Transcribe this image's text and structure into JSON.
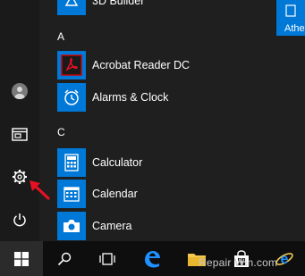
{
  "apps": {
    "partial_top_label": "3D Builder",
    "group_a": "A",
    "group_c": "C",
    "items": [
      {
        "label": "Acrobat Reader DC",
        "icon": "acrobat-icon"
      },
      {
        "label": "Alarms & Clock",
        "icon": "alarm-clock-icon"
      },
      {
        "label": "Calculator",
        "icon": "calculator-icon"
      },
      {
        "label": "Calendar",
        "icon": "calendar-icon"
      },
      {
        "label": "Camera",
        "icon": "camera-icon"
      }
    ]
  },
  "right_tile": {
    "label": "Athe"
  },
  "left_rail": [
    "user-avatar-icon",
    "file-explorer-icon",
    "settings-gear-icon",
    "power-icon"
  ],
  "taskbar": [
    "windows-start-icon",
    "search-icon",
    "task-view-icon",
    "edge-icon",
    "file-explorer-icon",
    "store-icon",
    "internet-explorer-icon"
  ],
  "watermark": "Repair Win.com",
  "colors": {
    "accent": "#0078d7",
    "background": "#1f1f1f",
    "taskbar": "#0e0e0e",
    "arrow": "#e81123"
  }
}
